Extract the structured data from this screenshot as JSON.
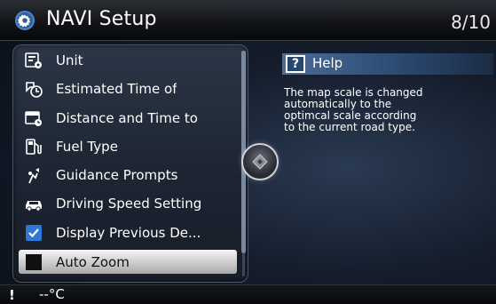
{
  "header": {
    "title": "NAVI Setup",
    "page_indicator": "8/10",
    "icon": "gear-icon"
  },
  "menu": {
    "items": [
      {
        "label": "Unit",
        "icon": "unit-icon"
      },
      {
        "label": "Estimated Time of",
        "icon": "estimated-time-icon"
      },
      {
        "label": "Distance and Time to",
        "icon": "distance-time-icon"
      },
      {
        "label": "Fuel Type",
        "icon": "fuel-icon"
      },
      {
        "label": "Guidance Prompts",
        "icon": "guidance-prompts-icon"
      },
      {
        "label": "Driving Speed Setting",
        "icon": "car-icon"
      },
      {
        "label": "Display Previous De...",
        "icon": "checkbox-checked-icon",
        "checked": true
      },
      {
        "label": "Auto Zoom",
        "icon": "checkbox-unchecked-icon",
        "checked": false,
        "selected": true
      }
    ]
  },
  "help": {
    "marker": "?",
    "title": "Help",
    "lines": [
      "The map scale is changed",
      "automatically to  the",
      "optimcal scale according",
      "to the current road type."
    ]
  },
  "status": {
    "alert": "!",
    "temperature": "--°C"
  },
  "colors": {
    "help_header": "#2c4a72",
    "checkbox_checked": "#2b78d6",
    "selected_row": "#d8d8d8"
  }
}
